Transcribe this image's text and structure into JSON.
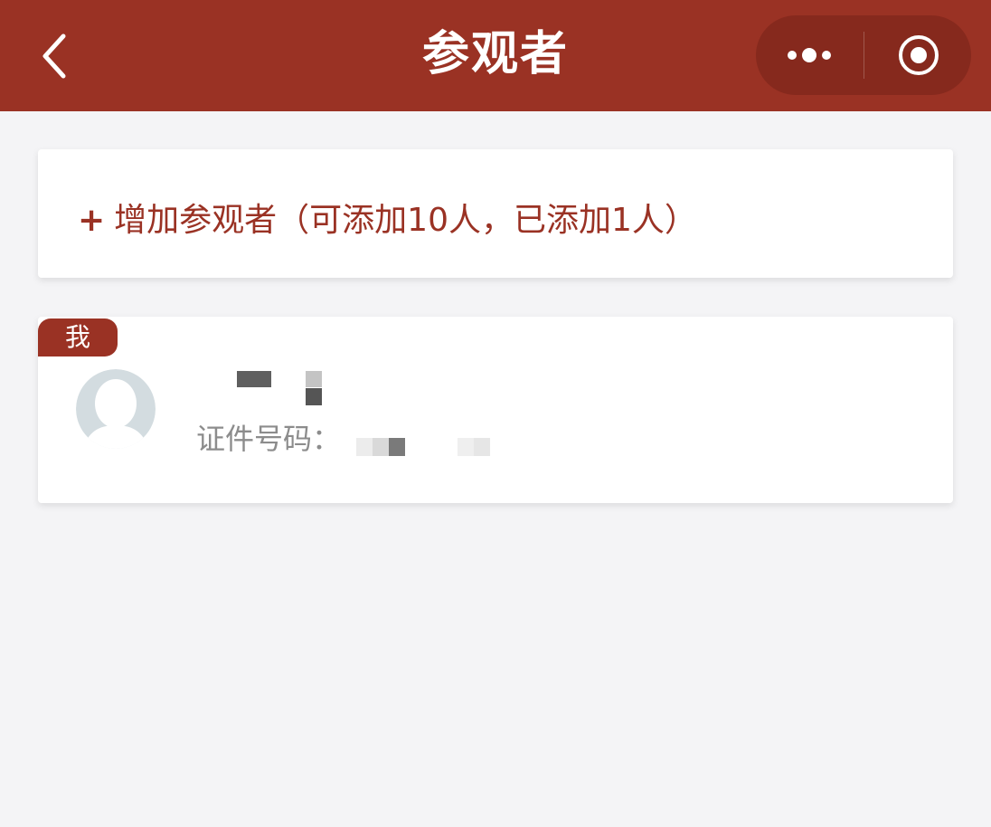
{
  "header": {
    "title": "参观者",
    "background_color": "#9a3224",
    "back_icon": "chevron-left-icon",
    "more_icon": "more-dots-icon",
    "close_icon": "target-close-icon"
  },
  "add_visitor": {
    "plus": "+",
    "label": "增加参观者（可添加10人，已添加1人）",
    "max_count": 10,
    "added_count": 1,
    "accent_color": "#9a3224"
  },
  "visitors": [
    {
      "badge": "我",
      "avatar_icon": "default-avatar-icon",
      "name_redacted": true,
      "id_label": "证件号码：",
      "id_redacted": true
    }
  ]
}
